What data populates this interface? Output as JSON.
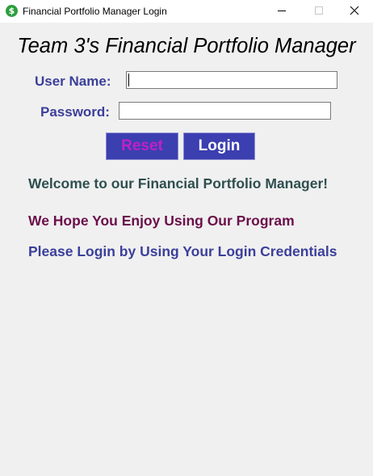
{
  "window": {
    "title": "Financial Portfolio Manager Login",
    "icon": "dollar-icon",
    "icon_glyph": "$",
    "controls": [
      "minimize-icon",
      "maximize-icon",
      "close-icon"
    ]
  },
  "heading": "Team 3's Financial Portfolio Manager",
  "form": {
    "username_label": "User Name:",
    "username_value": "",
    "password_label": "Password:",
    "password_value": ""
  },
  "buttons": {
    "reset_label": "Reset",
    "login_label": "Login"
  },
  "messages": {
    "welcome": "Welcome to our Financial Portfolio Manager!",
    "enjoy": "We Hope You Enjoy Using Our Program",
    "instruction": "Please Login by Using Your Login Credentials"
  },
  "colors": {
    "background": "#f0f0f0",
    "button_bg": "#3b3fb0",
    "reset_text": "#c020c8",
    "login_text": "#ffffff",
    "label_text": "#3b3f9a",
    "welcome_text": "#2f4f4f",
    "enjoy_text": "#6b0f4a",
    "instruction_text": "#3b3f9a"
  }
}
